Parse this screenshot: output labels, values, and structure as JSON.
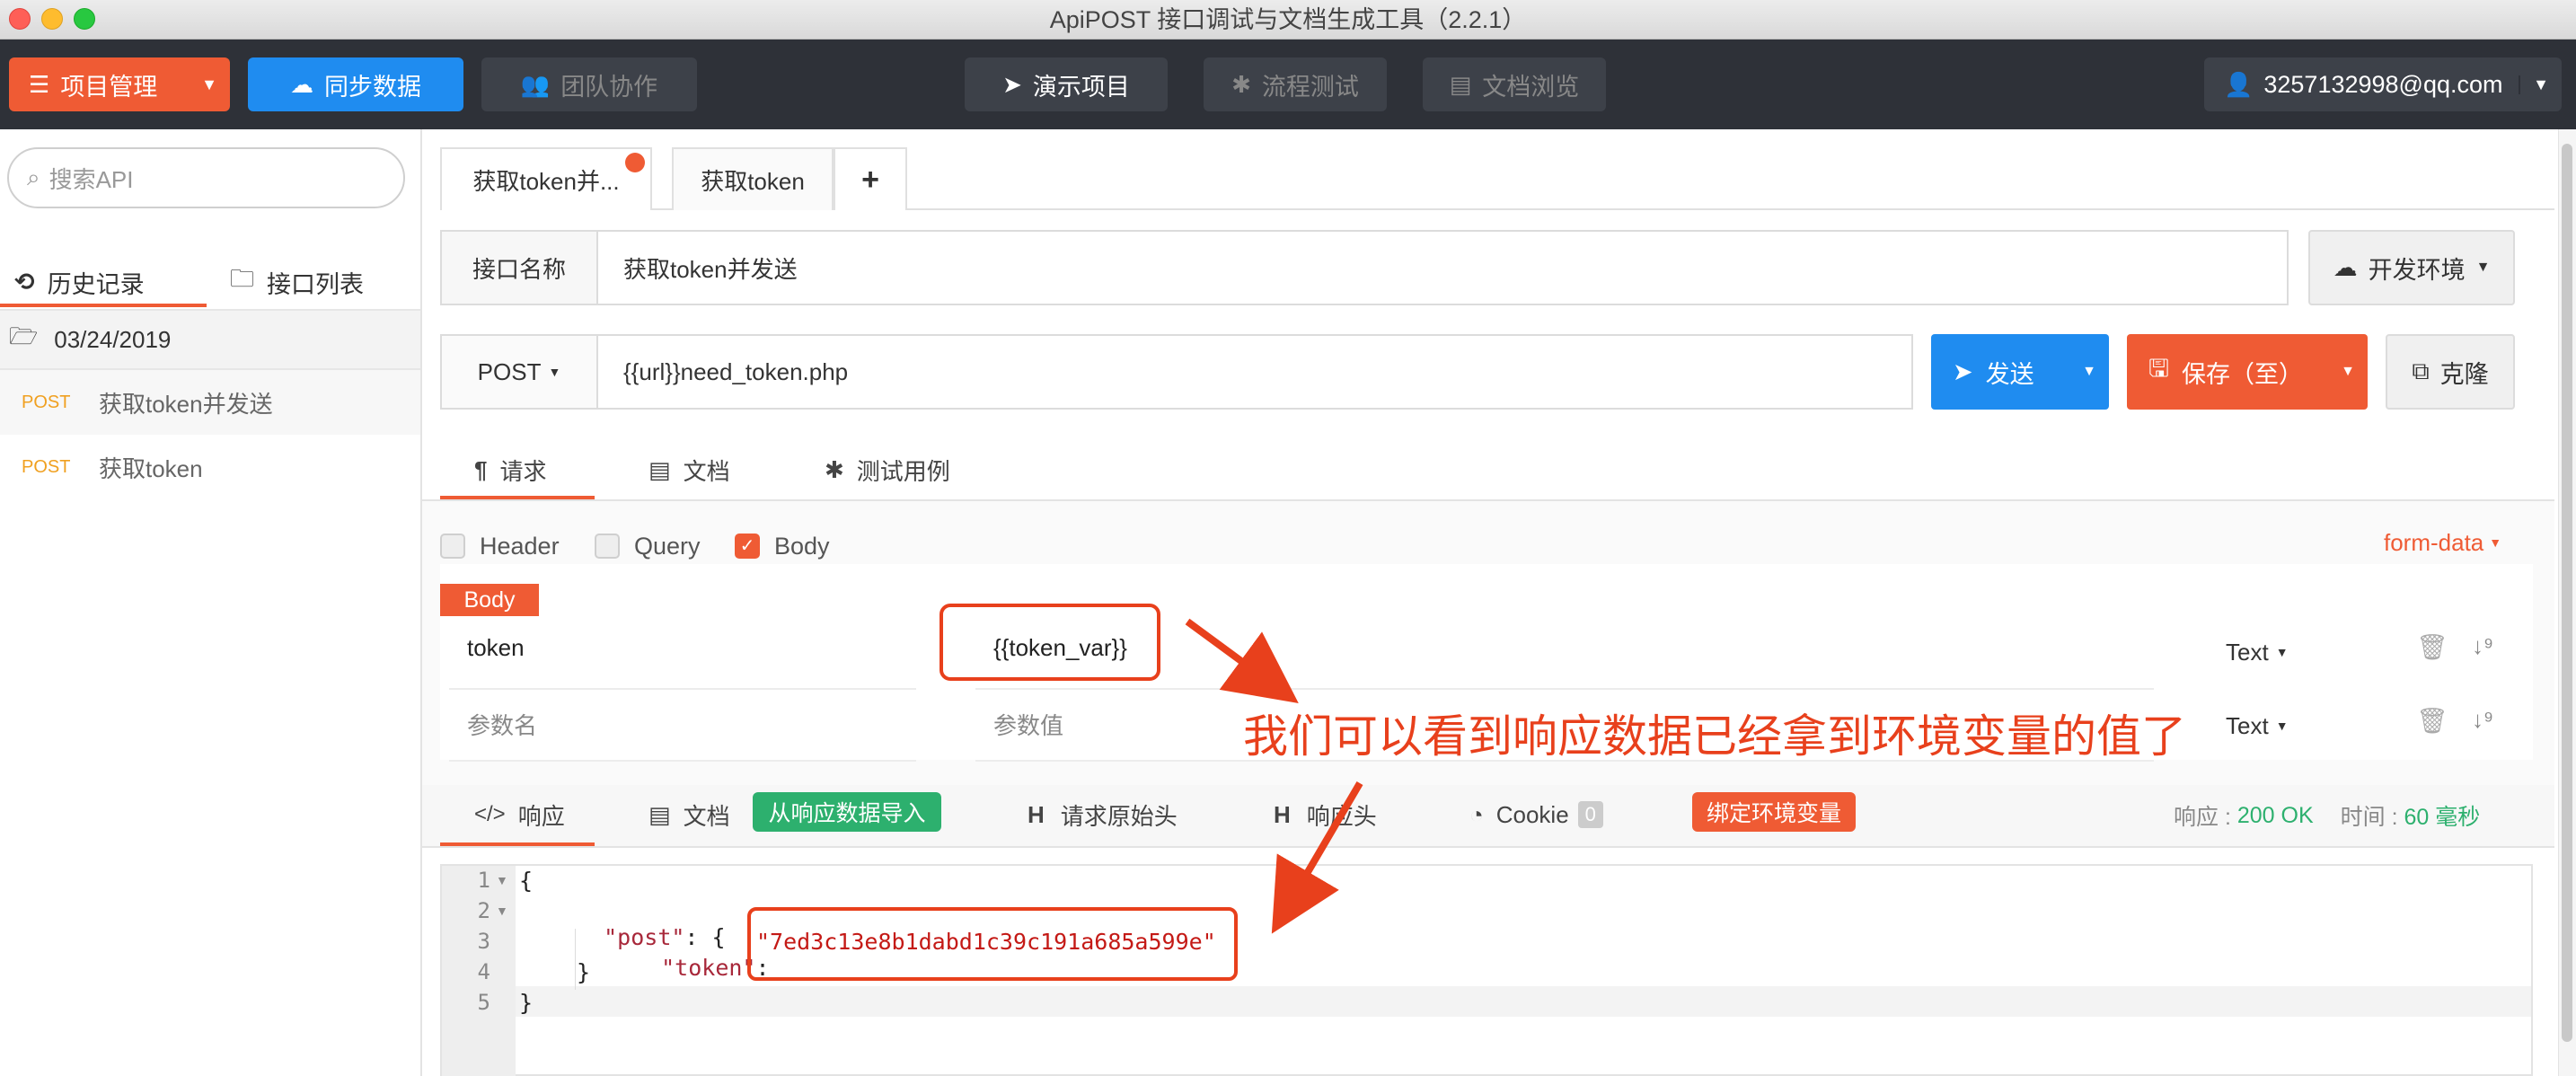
{
  "window": {
    "title": "ApiPOST 接口调试与文档生成工具（2.2.1）"
  },
  "toolbar": {
    "project_mgmt": "项目管理",
    "sync": "同步数据",
    "team": "团队协作",
    "demo": "演示项目",
    "flow_test": "流程测试",
    "doc_browse": "文档浏览",
    "account": "3257132998@qq.com"
  },
  "sidebar": {
    "search_placeholder": "搜索API",
    "tab_history": "历史记录",
    "tab_list": "接口列表",
    "date": "03/24/2019",
    "items": [
      {
        "method": "POST",
        "name": "获取token并发送"
      },
      {
        "method": "POST",
        "name": "获取token"
      }
    ]
  },
  "tabs": [
    {
      "label": "获取token并..."
    },
    {
      "label": "获取token"
    }
  ],
  "add_tab": "+",
  "api_name": {
    "label": "接口名称",
    "value": "获取token并发送"
  },
  "env": {
    "label": "开发环境"
  },
  "request": {
    "method": "POST",
    "url": "{{url}}need_token.php",
    "send": "发送",
    "save": "保存（至）",
    "clone": "克隆"
  },
  "req_tabs": {
    "request": "请求",
    "doc": "文档",
    "test": "测试用例"
  },
  "param_toggles": {
    "header": "Header",
    "query": "Query",
    "body": "Body",
    "mode": "form-data"
  },
  "body": {
    "badge": "Body",
    "rows": [
      {
        "name": "token",
        "value": "{{token_var}}",
        "type": "Text"
      },
      {
        "name": "参数名",
        "value": "参数值",
        "type": "Text"
      }
    ]
  },
  "annotation": "我们可以看到响应数据已经拿到环境变量的值了",
  "resp_tabs": {
    "response": "响应",
    "doc": "文档",
    "import": "从响应数据导入",
    "raw_req_header": "请求原始头",
    "resp_header": "响应头",
    "cookie": "Cookie",
    "cookie_count": "0",
    "bind_env": "绑定环境变量",
    "status_label": "响应 : ",
    "status_value": "200 OK",
    "time_label": "时间 : ",
    "time_value": "60 毫秒"
  },
  "response_lines": [
    "1",
    "2",
    "3",
    "4",
    "5"
  ],
  "response_json": {
    "open": "{",
    "post_key": "\"post\"",
    "post_open": ": {",
    "token_key": "\"token\"",
    "colon": ":",
    "token_value": "\"7ed3c13e8b1dabd1c39c191a685a599e\"",
    "inner_close": "}",
    "close": "}"
  },
  "colors": {
    "accent_orange": "#ef5b34",
    "primary_blue": "#1f8cf0",
    "toolbar_bg": "#2e3138",
    "success_green": "#2db06e",
    "annotation_red": "#e8401c"
  }
}
